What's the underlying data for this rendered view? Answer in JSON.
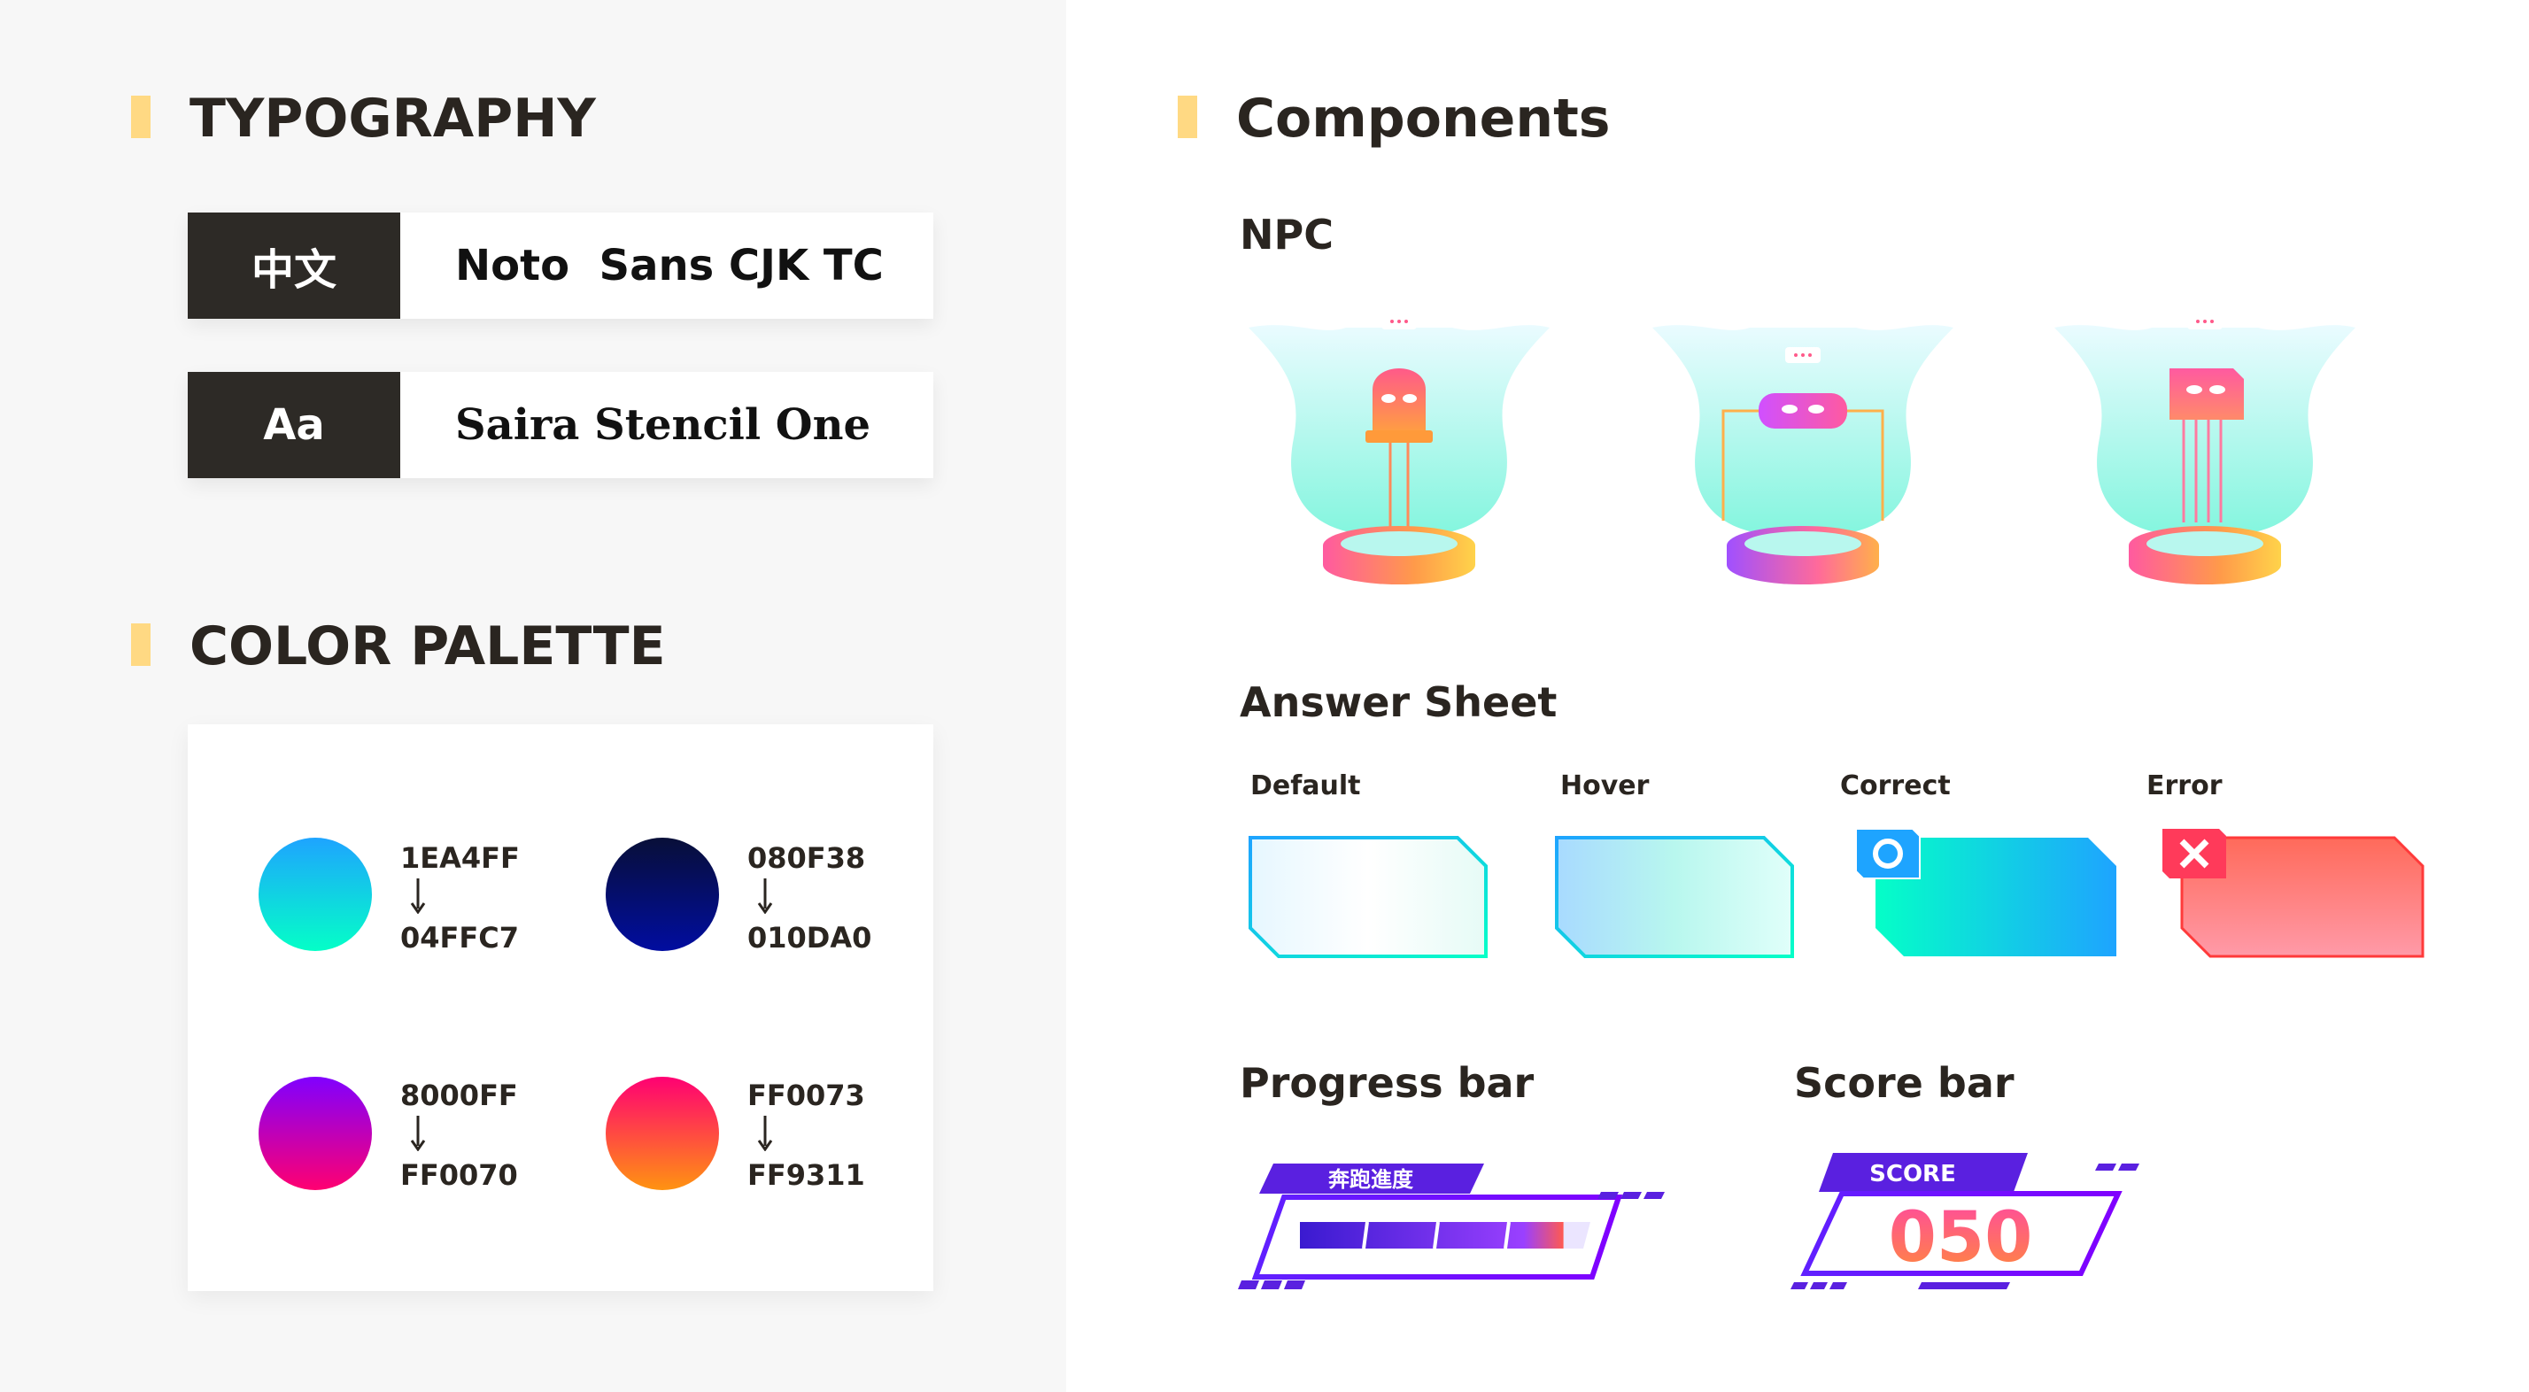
{
  "typography": {
    "title": "TYPOGRAPHY",
    "fonts": [
      {
        "tag": "中文",
        "name": "Noto  Sans CJK TC"
      },
      {
        "tag": "Aa",
        "name": "Saira Stencil One"
      }
    ]
  },
  "palette": {
    "title": "COLOR PALETTE",
    "gradients": [
      {
        "from": "1EA4FF",
        "to": "04FFC7"
      },
      {
        "from": "080F38",
        "to": "010DA0"
      },
      {
        "from": "8000FF",
        "to": "FF0070"
      },
      {
        "from": "FF0073",
        "to": "FF9311"
      }
    ]
  },
  "components": {
    "title": "Components",
    "npc": {
      "title": "NPC",
      "icons": [
        "led-robot-icon",
        "resistor-robot-icon",
        "chip-robot-icon"
      ]
    },
    "answer_sheet": {
      "title": "Answer Sheet",
      "states": [
        {
          "label": "Default"
        },
        {
          "label": "Hover"
        },
        {
          "label": "Correct",
          "icon": "circle-icon"
        },
        {
          "label": "Error",
          "icon": "cross-icon"
        }
      ]
    },
    "progress_bar": {
      "title": "Progress bar",
      "label": "奔跑進度",
      "progress": 0.93
    },
    "score_bar": {
      "title": "Score bar",
      "label": "SCORE",
      "value": "050"
    }
  },
  "colors": {
    "section_accent": "#FFD983",
    "dark": "#2D2A26",
    "panel_bg": "#F7F7F7"
  }
}
